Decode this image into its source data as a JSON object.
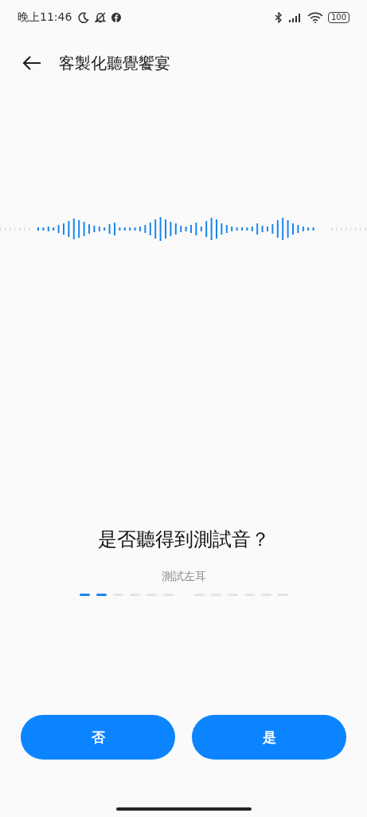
{
  "status_bar": {
    "time": "晚上11:46",
    "battery": "100"
  },
  "header": {
    "title": "客製化聽覺饗宴"
  },
  "prompt": {
    "question": "是否聽得到測試音？",
    "ear": "測試左耳"
  },
  "progress": {
    "groups": [
      {
        "steps": [
          {
            "done": true
          },
          {
            "done": true
          },
          {
            "done": false
          },
          {
            "done": false
          },
          {
            "done": false
          },
          {
            "done": false
          }
        ]
      },
      {
        "steps": [
          {
            "done": false
          },
          {
            "done": false
          },
          {
            "done": false
          },
          {
            "done": false
          },
          {
            "done": false
          },
          {
            "done": false
          }
        ]
      }
    ]
  },
  "buttons": [
    {
      "label": "否"
    },
    {
      "label": "是"
    }
  ]
}
